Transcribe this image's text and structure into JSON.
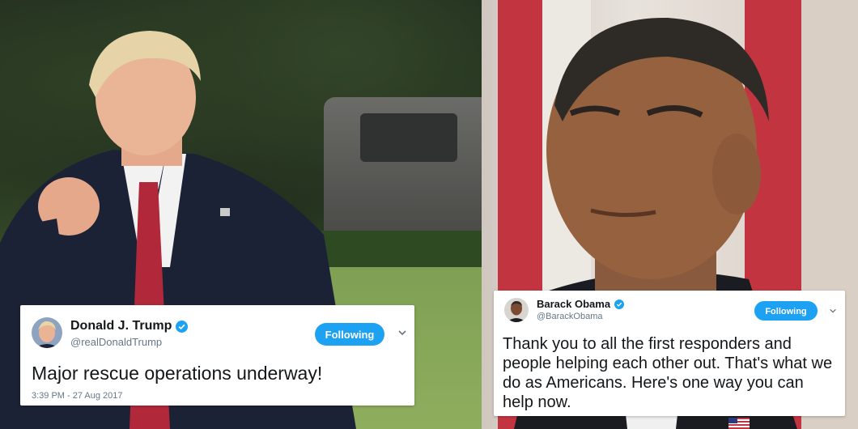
{
  "tweets": {
    "trump": {
      "name": "Donald J. Trump",
      "handle": "@realDonaldTrump",
      "follow_label": "Following",
      "text": "Major rescue operations underway!",
      "timestamp": "3:39 PM - 27 Aug 2017",
      "verified": true
    },
    "obama": {
      "name": "Barack Obama",
      "handle": "@BarackObama",
      "follow_label": "Following",
      "text": "Thank you to all the first responders and people helping each other out. That's what we do as Americans. Here's one way you can help now.",
      "verified": true
    }
  },
  "colors": {
    "accent": "#1da1f2",
    "text": "#14171a",
    "muted": "#657786"
  }
}
